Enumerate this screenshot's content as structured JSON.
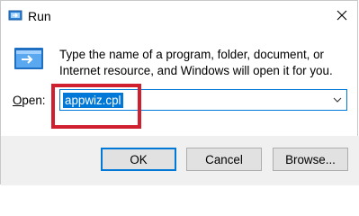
{
  "window": {
    "title": "Run",
    "icon": "run-app-icon",
    "close_icon": "close-icon"
  },
  "body": {
    "description": "Type the name of a program, folder, document, or Internet resource, and Windows will open it for you.",
    "big_icon": "run-dialog-icon"
  },
  "open_field": {
    "label": "Open:",
    "label_rest": "pen:",
    "label_accel": "O",
    "value": "appwiz.cpl",
    "dropdown_icon": "chevron-down-icon"
  },
  "buttons": {
    "ok": "OK",
    "cancel": "Cancel",
    "browse": "Browse..."
  },
  "colors": {
    "accent": "#0078d7",
    "highlight_box": "#d01f2e",
    "footer": "#f0f0f0"
  }
}
